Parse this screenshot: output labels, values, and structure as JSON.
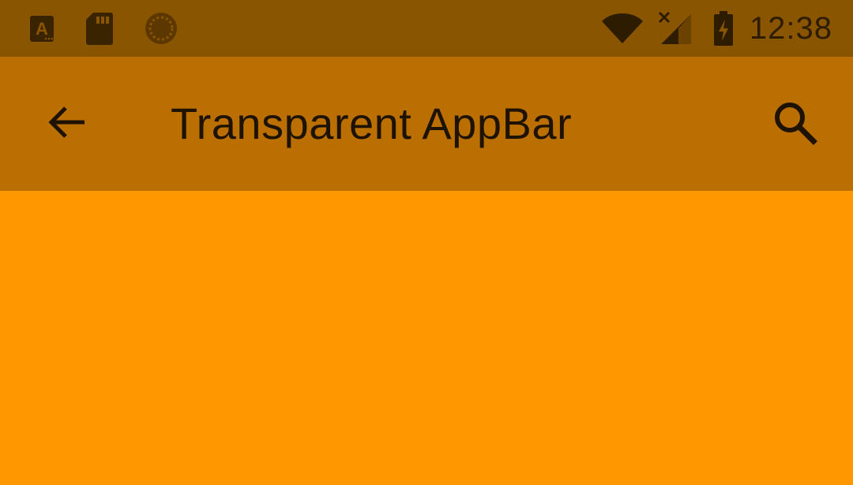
{
  "status_bar": {
    "time": "12:38",
    "icons": [
      "accessibility-a-icon",
      "sd-card-icon",
      "sync-progress-icon",
      "wifi-icon",
      "cellular-no-signal-icon",
      "battery-charging-icon"
    ]
  },
  "app_bar": {
    "title": "Transparent AppBar",
    "back_icon": "arrow-back-icon",
    "search_icon": "search-icon"
  },
  "colors": {
    "status_bar_bg": "#8A5500",
    "app_bar_bg": "#BA6F00",
    "content_bg": "#FF9800",
    "foreground": "#1E1303"
  }
}
